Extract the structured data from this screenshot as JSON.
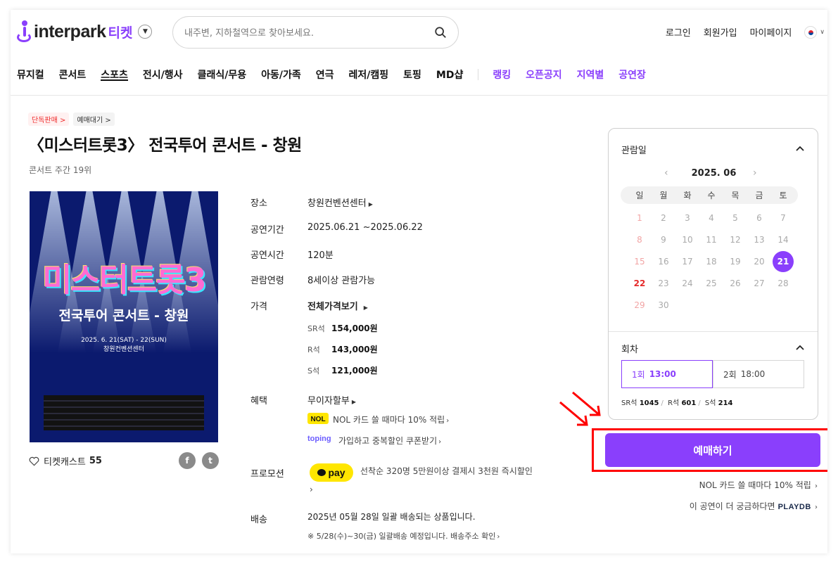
{
  "header": {
    "logo_text": "interpark",
    "logo_sub": "티켓",
    "search_placeholder": "내주변, 지하철역으로 찾아보세요.",
    "links": [
      "로그인",
      "회원가입",
      "마이페이지"
    ]
  },
  "nav": {
    "main": [
      "뮤지컬",
      "콘서트",
      "스포츠",
      "전시/행사",
      "클래식/무용",
      "아동/가족",
      "연극",
      "레저/캠핑",
      "토핑",
      "MD샵"
    ],
    "active": "스포츠",
    "extra": [
      "랭킹",
      "오픈공지",
      "지역별",
      "공연장"
    ]
  },
  "product": {
    "badges": [
      "단독판매 >",
      "예매대기 >"
    ],
    "title": "〈미스터트롯3〉 전국투어 콘서트 - 창원",
    "rank": "콘서트 주간 19위",
    "poster": {
      "title": "미스터트롯3",
      "subtitle": "전국투어 콘서트 - 창원",
      "date": "2025. 6. 21(SAT) - 22(SUN)",
      "venue": "창원컨벤션센터"
    },
    "ticketcast_label": "티켓캐스트",
    "ticketcast_count": "55"
  },
  "info": {
    "venue_label": "장소",
    "venue_value": "창원컨벤션센터",
    "period_label": "공연기간",
    "period_value": "2025.06.21 ~2025.06.22",
    "runtime_label": "공연시간",
    "runtime_value": "120분",
    "age_label": "관람연령",
    "age_value": "8세이상 관람가능",
    "price_label": "가격",
    "price_all": "전체가격보기",
    "prices": [
      {
        "grade": "SR석",
        "price": "154,000원"
      },
      {
        "grade": "R석",
        "price": "143,000원"
      },
      {
        "grade": "S석",
        "price": "121,000원"
      }
    ],
    "benefit_label": "혜택",
    "benefit_value": "무이자할부",
    "nol_text": "NOL 카드 쓸 때마다 10% 적립",
    "toping_logo": "toping",
    "toping_text": "가입하고 중복할인 쿠폰받기",
    "promo_label": "프로모션",
    "kpay_label": "pay",
    "promo_text": "선착순 320명 5만원이상 결제시 3천원 즉시할인",
    "delivery_label": "배송",
    "delivery_text": "2025년 05월 28일 일괄 배송되는 상품입니다.",
    "delivery_note": "※ 5/28(수)~30(금) 일괄배송 예정입니다. 배송주소 확인"
  },
  "calendar": {
    "heading": "관람일",
    "month": "2025. 06",
    "weekdays": [
      "일",
      "월",
      "화",
      "수",
      "목",
      "금",
      "토"
    ],
    "selected_day": "21",
    "session_heading": "회차",
    "sessions": [
      {
        "round": "1회",
        "time": "13:00"
      },
      {
        "round": "2회",
        "time": "18:00"
      }
    ],
    "seats": [
      {
        "grade": "SR석",
        "count": "1045"
      },
      {
        "grade": "R석",
        "count": "601"
      },
      {
        "grade": "S석",
        "count": "214"
      }
    ]
  },
  "booking": {
    "button": "예매하기",
    "nol_note": "NOL 카드 쓸 때마다 10% 적립",
    "playdb_note": "이 공연이 더 궁금하다면",
    "playdb_logo": "PLAYDB"
  },
  "colors": {
    "accent": "#8a3ffc",
    "highlight": "#ff0000",
    "kpay": "#ffe600"
  }
}
